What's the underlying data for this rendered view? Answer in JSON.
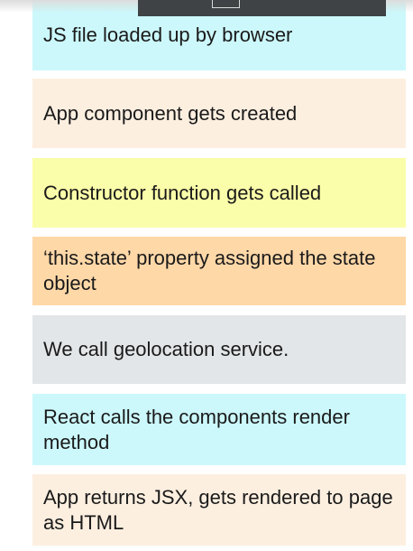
{
  "steps": [
    {
      "text": "JS file loaded up by browser",
      "color": "#ccf8fb"
    },
    {
      "text": "App component gets created",
      "color": "#fdefe0"
    },
    {
      "text": "Constructor function gets called",
      "color": "#fafda9"
    },
    {
      "text": "‘this.state’ property assigned the state object",
      "color": "#ffd8a8"
    },
    {
      "text": "We call geolocation service.",
      "color": "#e3e6e8"
    },
    {
      "text": "React calls the components render method",
      "color": "#ccf8fb"
    },
    {
      "text": "App returns JSX, gets rendered to page as HTML",
      "color": "#fdefe0"
    }
  ]
}
